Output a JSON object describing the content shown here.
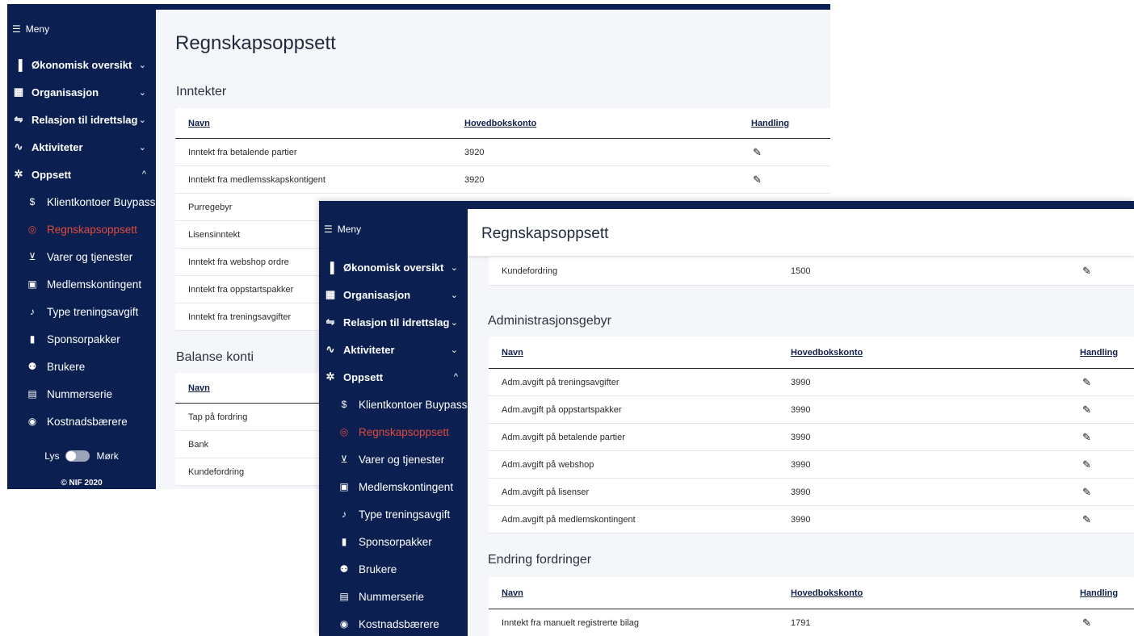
{
  "menu_label": "Meny",
  "nav": [
    {
      "label": "Økonomisk oversikt",
      "icon": "bar-chart-icon",
      "chev": "⌄"
    },
    {
      "label": "Organisasjon",
      "icon": "bank-icon",
      "chev": "⌄"
    },
    {
      "label": "Relasjon til idrettslag",
      "icon": "relation-icon",
      "chev": "⌄"
    },
    {
      "label": "Aktiviteter",
      "icon": "pulse-icon",
      "chev": "⌄"
    },
    {
      "label": "Oppsett",
      "icon": "gear-icon",
      "chev": "^"
    }
  ],
  "subnav": [
    {
      "label": "Klientkontoer Buypass",
      "icon": "dollar-circle-icon"
    },
    {
      "label": "Regnskapsoppsett",
      "icon": "settings-circle-icon",
      "active": true
    },
    {
      "label": "Varer og tjenester",
      "icon": "cart-icon"
    },
    {
      "label": "Medlemskontingent",
      "icon": "card-icon"
    },
    {
      "label": "Type treningsavgift",
      "icon": "whistle-icon"
    },
    {
      "label": "Sponsorpakker",
      "icon": "ticket-icon"
    },
    {
      "label": "Brukere",
      "icon": "users-icon"
    },
    {
      "label": "Nummerserie",
      "icon": "calculator-icon"
    },
    {
      "label": "Kostnadsbærere",
      "icon": "coins-icon"
    }
  ],
  "theme": {
    "light": "Lys",
    "dark": "Mørk"
  },
  "copyright": "© NIF 2020",
  "page_title": "Regnskapsoppsett",
  "columns": {
    "name": "Navn",
    "account": "Hovedbokskonto",
    "action": "Handling"
  },
  "inntekter": {
    "title": "Inntekter",
    "rows": [
      {
        "name": "Inntekt fra betalende partier",
        "account": "3920"
      },
      {
        "name": "Inntekt fra medlemsskapskontigent",
        "account": "3920"
      },
      {
        "name": "Purregebyr",
        "account": ""
      },
      {
        "name": "Lisensinntekt",
        "account": ""
      },
      {
        "name": "Inntekt fra webshop ordre",
        "account": ""
      },
      {
        "name": "Inntekt fra oppstartspakker",
        "account": ""
      },
      {
        "name": "Inntekt fra treningsavgifter",
        "account": ""
      }
    ]
  },
  "balanse": {
    "title": "Balanse konti",
    "rows": [
      {
        "name": "Tap på fordring"
      },
      {
        "name": "Bank"
      },
      {
        "name": "Kundefordring"
      }
    ]
  },
  "kundefordring_row": {
    "name": "Kundefordring",
    "account": "1500"
  },
  "admin": {
    "title": "Administrasjonsgebyr",
    "rows": [
      {
        "name": "Adm.avgift på treningsavgifter",
        "account": "3990"
      },
      {
        "name": "Adm.avgift på oppstartspakker",
        "account": "3990"
      },
      {
        "name": "Adm.avgift på betalende partier",
        "account": "3990"
      },
      {
        "name": "Adm.avgift på webshop",
        "account": "3990"
      },
      {
        "name": "Adm.avgift på lisenser",
        "account": "3990"
      },
      {
        "name": "Adm.avgift på medlemskontingent",
        "account": "3990"
      }
    ]
  },
  "endring": {
    "title": "Endring fordringer",
    "rows": [
      {
        "name": "Inntekt fra manuelt registrerte bilag",
        "account": "1791"
      }
    ]
  },
  "colors": {
    "sidebar": "#0b2050",
    "active": "#e04a3c",
    "background": "#f4f6fa"
  }
}
